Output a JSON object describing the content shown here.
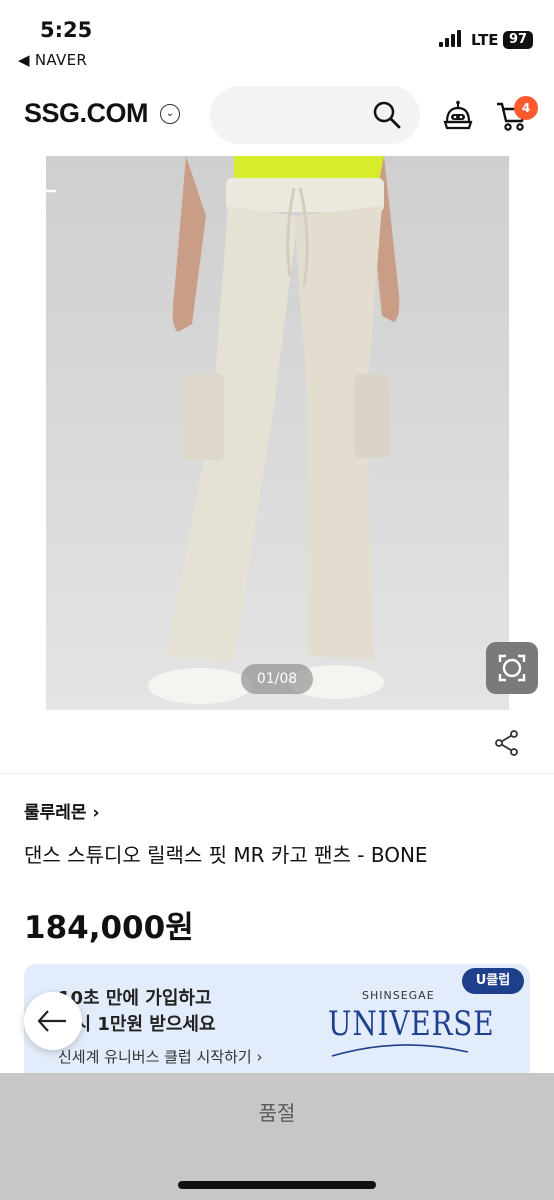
{
  "status_bar": {
    "time": "5:25",
    "back_app": "◀ NAVER",
    "network": "LTE",
    "battery": "97"
  },
  "header": {
    "logo": "SSG.COM",
    "logo_dropdown_icon": "chevron-down-icon",
    "search_icon": "search-icon",
    "bot_icon": "bot-icon",
    "cart_icon": "cart-icon",
    "cart_count": "4"
  },
  "gallery": {
    "counter": "01/08",
    "back_icon": "arrow-left-icon",
    "lens_icon": "camera-lens-icon"
  },
  "share_icon": "share-icon",
  "product": {
    "brand": "룰루레몬 ›",
    "name": "댄스 스튜디오 릴랙스 핏 MR 카고 팬츠 - BONE",
    "price": "184,000원"
  },
  "banner": {
    "line1": "10초 만에 가입하고",
    "line2": "즉시 1만원 받으세요",
    "link": "신세계 유니버스 클럽 시작하기 ›",
    "badge": "U클럽",
    "brand_small": "SHINSEGAE",
    "brand_big": "UNIVERSE"
  },
  "bottom": {
    "soldout": "품절"
  },
  "colors": {
    "cart_badge": "#ff5a2e",
    "universe_blue": "#1f3f8f",
    "banner_bg": "#e3ecfa",
    "soldout_bg": "#c7c7c7"
  }
}
